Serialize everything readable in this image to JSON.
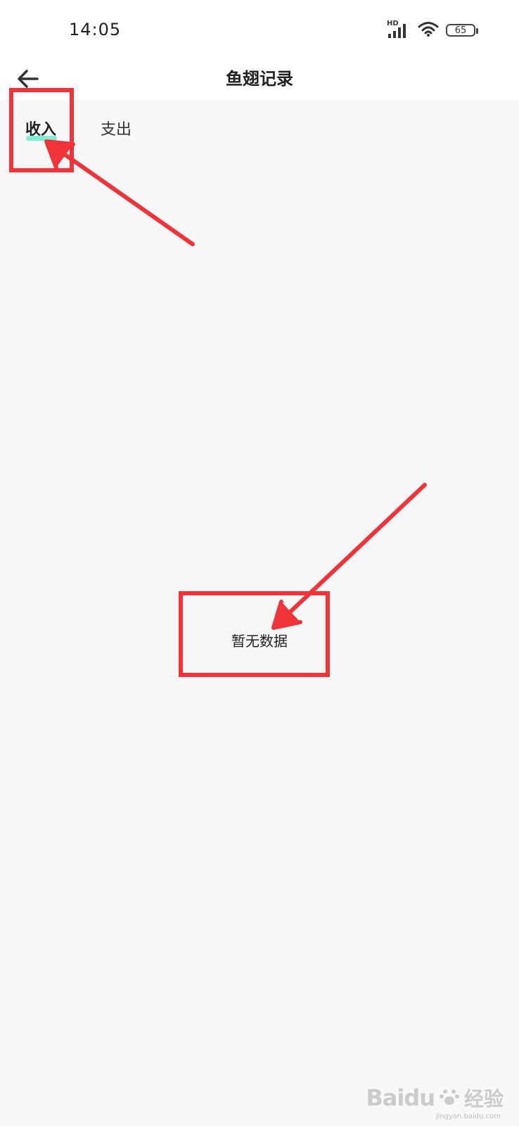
{
  "status_bar": {
    "time": "14:05",
    "network_label": "HD",
    "battery_level": "65"
  },
  "nav": {
    "title": "鱼翅记录"
  },
  "tabs": [
    {
      "label": "收入",
      "active": true
    },
    {
      "label": "支出",
      "active": false
    }
  ],
  "empty_state": {
    "text": "暂无数据"
  },
  "watermark": {
    "brand": "Baidu",
    "brand_cn": "经验",
    "url": "jingyan.baidu.com"
  },
  "colors": {
    "tab_indicator": "#7ff0d6",
    "annotation_red": "#f2343a",
    "background": "#f8f8f8"
  }
}
